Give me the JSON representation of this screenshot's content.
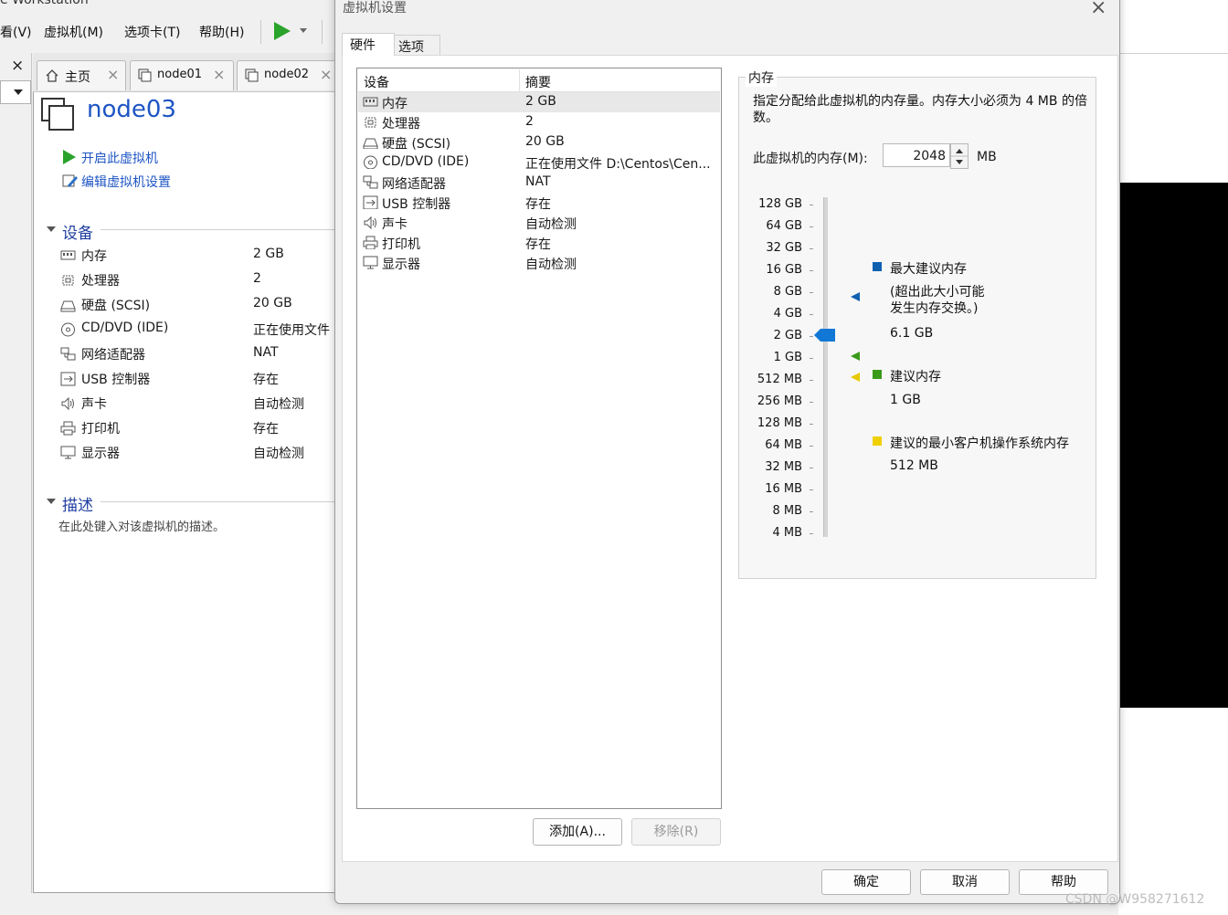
{
  "app": {
    "title": "e Workstation",
    "menu": [
      "看(V)",
      "虚拟机(M)",
      "选项卡(T)",
      "帮助(H)"
    ],
    "left_close": "×",
    "tabs": [
      {
        "label": "主页",
        "close": "×"
      },
      {
        "label": "node01",
        "close": "×"
      },
      {
        "label": "node02",
        "close": "×"
      }
    ],
    "vm_name": "node03",
    "actions": [
      "开启此虚拟机",
      "编辑虚拟机设置"
    ],
    "devices_section": "设备",
    "devices": [
      {
        "name": "内存",
        "value": "2 GB",
        "icon": "memory-icon"
      },
      {
        "name": "处理器",
        "value": "2",
        "icon": "processor-icon"
      },
      {
        "name": "硬盘 (SCSI)",
        "value": "20 GB",
        "icon": "harddisk-icon"
      },
      {
        "name": "CD/DVD (IDE)",
        "value": "正在使用文件",
        "icon": "cdrom-icon"
      },
      {
        "name": "网络适配器",
        "value": "NAT",
        "icon": "network-icon"
      },
      {
        "name": "USB 控制器",
        "value": "存在",
        "icon": "usb-icon"
      },
      {
        "name": "声卡",
        "value": "自动检测",
        "icon": "sound-icon"
      },
      {
        "name": "打印机",
        "value": "存在",
        "icon": "printer-icon"
      },
      {
        "name": "显示器",
        "value": "自动检测",
        "icon": "display-icon"
      }
    ],
    "description_section": "描述",
    "description_placeholder": "在此处键入对该虚拟机的描述。"
  },
  "dialog": {
    "title": "虚拟机设置",
    "close": "×",
    "tabs": [
      "硬件",
      "选项"
    ],
    "list_headers": [
      "设备",
      "摘要"
    ],
    "devices": [
      {
        "name": "内存",
        "summary": "2 GB",
        "selected": true
      },
      {
        "name": "处理器",
        "summary": "2"
      },
      {
        "name": "硬盘 (SCSI)",
        "summary": "20 GB"
      },
      {
        "name": "CD/DVD (IDE)",
        "summary": "正在使用文件 D:\\Centos\\Cen..."
      },
      {
        "name": "网络适配器",
        "summary": "NAT"
      },
      {
        "name": "USB 控制器",
        "summary": "存在"
      },
      {
        "name": "声卡",
        "summary": "自动检测"
      },
      {
        "name": "打印机",
        "summary": "存在"
      },
      {
        "name": "显示器",
        "summary": "自动检测"
      }
    ],
    "add_button": "添加(A)...",
    "remove_button": "移除(R)",
    "ok_button": "确定",
    "cancel_button": "取消",
    "help_button": "帮助"
  },
  "memory": {
    "group_title": "内存",
    "description": "指定分配给此虚拟机的内存量。内存大小必须为 4 MB 的倍数。",
    "label": "此虚拟机的内存(M):",
    "value": "2048",
    "unit": "MB",
    "scale": [
      "128 GB",
      "64 GB",
      "32 GB",
      "16 GB",
      "8 GB",
      "4 GB",
      "2 GB",
      "1 GB",
      "512 MB",
      "256 MB",
      "128 MB",
      "64 MB",
      "32 MB",
      "16 MB",
      "8 MB",
      "4 MB"
    ],
    "current_level": "2 GB",
    "legend": [
      {
        "label": "最大建议内存",
        "note": "(超出此大小可能\n发生内存交换。)",
        "value": "6.1 GB",
        "color": "#1060b0"
      },
      {
        "label": "建议内存",
        "value": "1 GB",
        "color": "#3a9a1a"
      },
      {
        "label": "建议的最小客户机操作系统内存",
        "value": "512 MB",
        "color": "#f0d000"
      }
    ]
  },
  "watermark": "CSDN @W958271612"
}
